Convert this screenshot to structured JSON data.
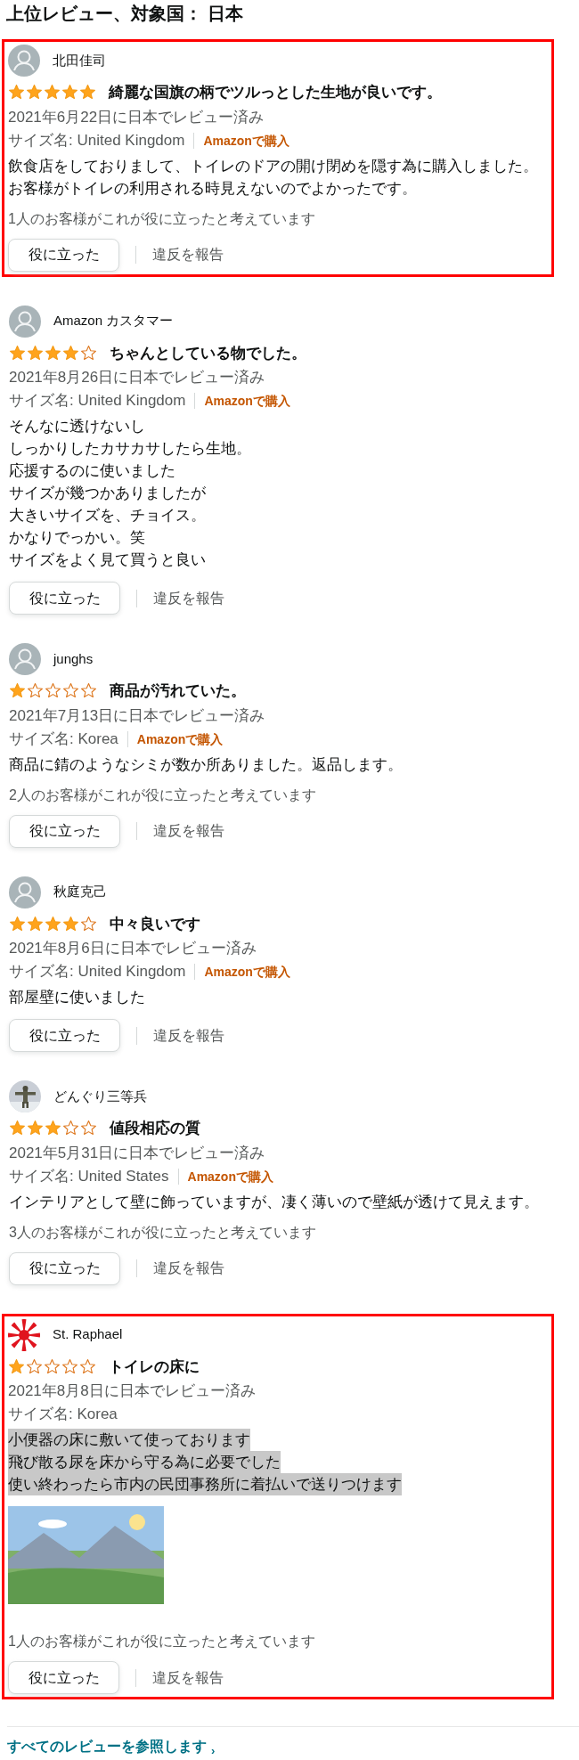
{
  "heading": "上位レビュー、対象国： 日本",
  "reviews": [
    {
      "highlighted": true,
      "avatar": {
        "kind": "default"
      },
      "name": "北田佳司",
      "stars": 5,
      "title": "綺麗な国旗の柄でツルっとした生地が良いです。",
      "date": "2021年6月22日に日本でレビュー済み",
      "size": "サイズ名: United Kingdom",
      "badge": "Amazonで購入",
      "text_selected": false,
      "body": [
        "飲食店をしておりまして、トイレのドアの開け閉めを隠す為に購入しました。お客様がトイレの利用される時見えないのでよかったです。"
      ],
      "helpful_count": "1人のお客様がこれが役に立ったと考えています",
      "helpful_button": "役に立った",
      "report": "違反を報告"
    },
    {
      "highlighted": false,
      "avatar": {
        "kind": "default"
      },
      "name": "Amazon カスタマー",
      "stars": 4,
      "title": "ちゃんとしている物でした。",
      "date": "2021年8月26日に日本でレビュー済み",
      "size": "サイズ名: United Kingdom",
      "badge": "Amazonで購入",
      "text_selected": false,
      "body": [
        "そんなに透けないし",
        "しっかりしたカサカサしたら生地。",
        "応援するのに使いました",
        "サイズが幾つかありましたが",
        "大きいサイズを、チョイス。",
        "かなりでっかい。笑",
        "サイズをよく見て買うと良い"
      ],
      "helpful_button": "役に立った",
      "report": "違反を報告"
    },
    {
      "highlighted": false,
      "avatar": {
        "kind": "default"
      },
      "name": "junghs",
      "stars": 1,
      "title": "商品が汚れていた。",
      "date": "2021年7月13日に日本でレビュー済み",
      "size": "サイズ名: Korea",
      "badge": "Amazonで購入",
      "text_selected": false,
      "body": [
        "商品に錆のようなシミが数か所ありました。返品します。"
      ],
      "helpful_count": "2人のお客様がこれが役に立ったと考えています",
      "helpful_button": "役に立った",
      "report": "違反を報告"
    },
    {
      "highlighted": false,
      "avatar": {
        "kind": "default"
      },
      "name": "秋庭克己",
      "stars": 4,
      "title": "中々良いです",
      "date": "2021年8月6日に日本でレビュー済み",
      "size": "サイズ名: United Kingdom",
      "badge": "Amazonで購入",
      "text_selected": false,
      "body": [
        "部屋壁に使いました"
      ],
      "helpful_button": "役に立った",
      "report": "違反を報告"
    },
    {
      "highlighted": false,
      "name": "どんぐり三等兵",
      "stars": 3,
      "title": "値段相応の質",
      "date": "2021年5月31日に日本でレビュー済み",
      "size": "サイズ名: United States",
      "badge": "Amazonで購入",
      "text_selected": false,
      "body": [
        "インテリアとして壁に飾っていますが、凄く薄いので壁紙が透けて見えます。"
      ],
      "helpful_count": "3人のお客様がこれが役に立ったと考えています",
      "helpful_button": "役に立った",
      "report": "違反を報告"
    },
    {
      "highlighted": true,
      "avatar": {
        "kind": "sunburst"
      },
      "name": "St. Raphael",
      "stars": 1,
      "title": "トイレの床に",
      "date": "2021年8月8日に日本でレビュー済み",
      "size": "サイズ名: Korea",
      "text_selected": true,
      "body": [
        "小便器の床に敷いて使っております",
        "飛び散る尿を床から守る為に必要でした",
        "使い終わったら市内の民団事務所に着払いで送りつけます"
      ],
      "helpful_count": "1人のお客様がこれが役に立ったと考えています",
      "helpful_button": "役に立った",
      "report": "違反を報告"
    }
  ],
  "see_all": {
    "label": "すべてのレビューを参照します",
    "chevron": "›"
  }
}
